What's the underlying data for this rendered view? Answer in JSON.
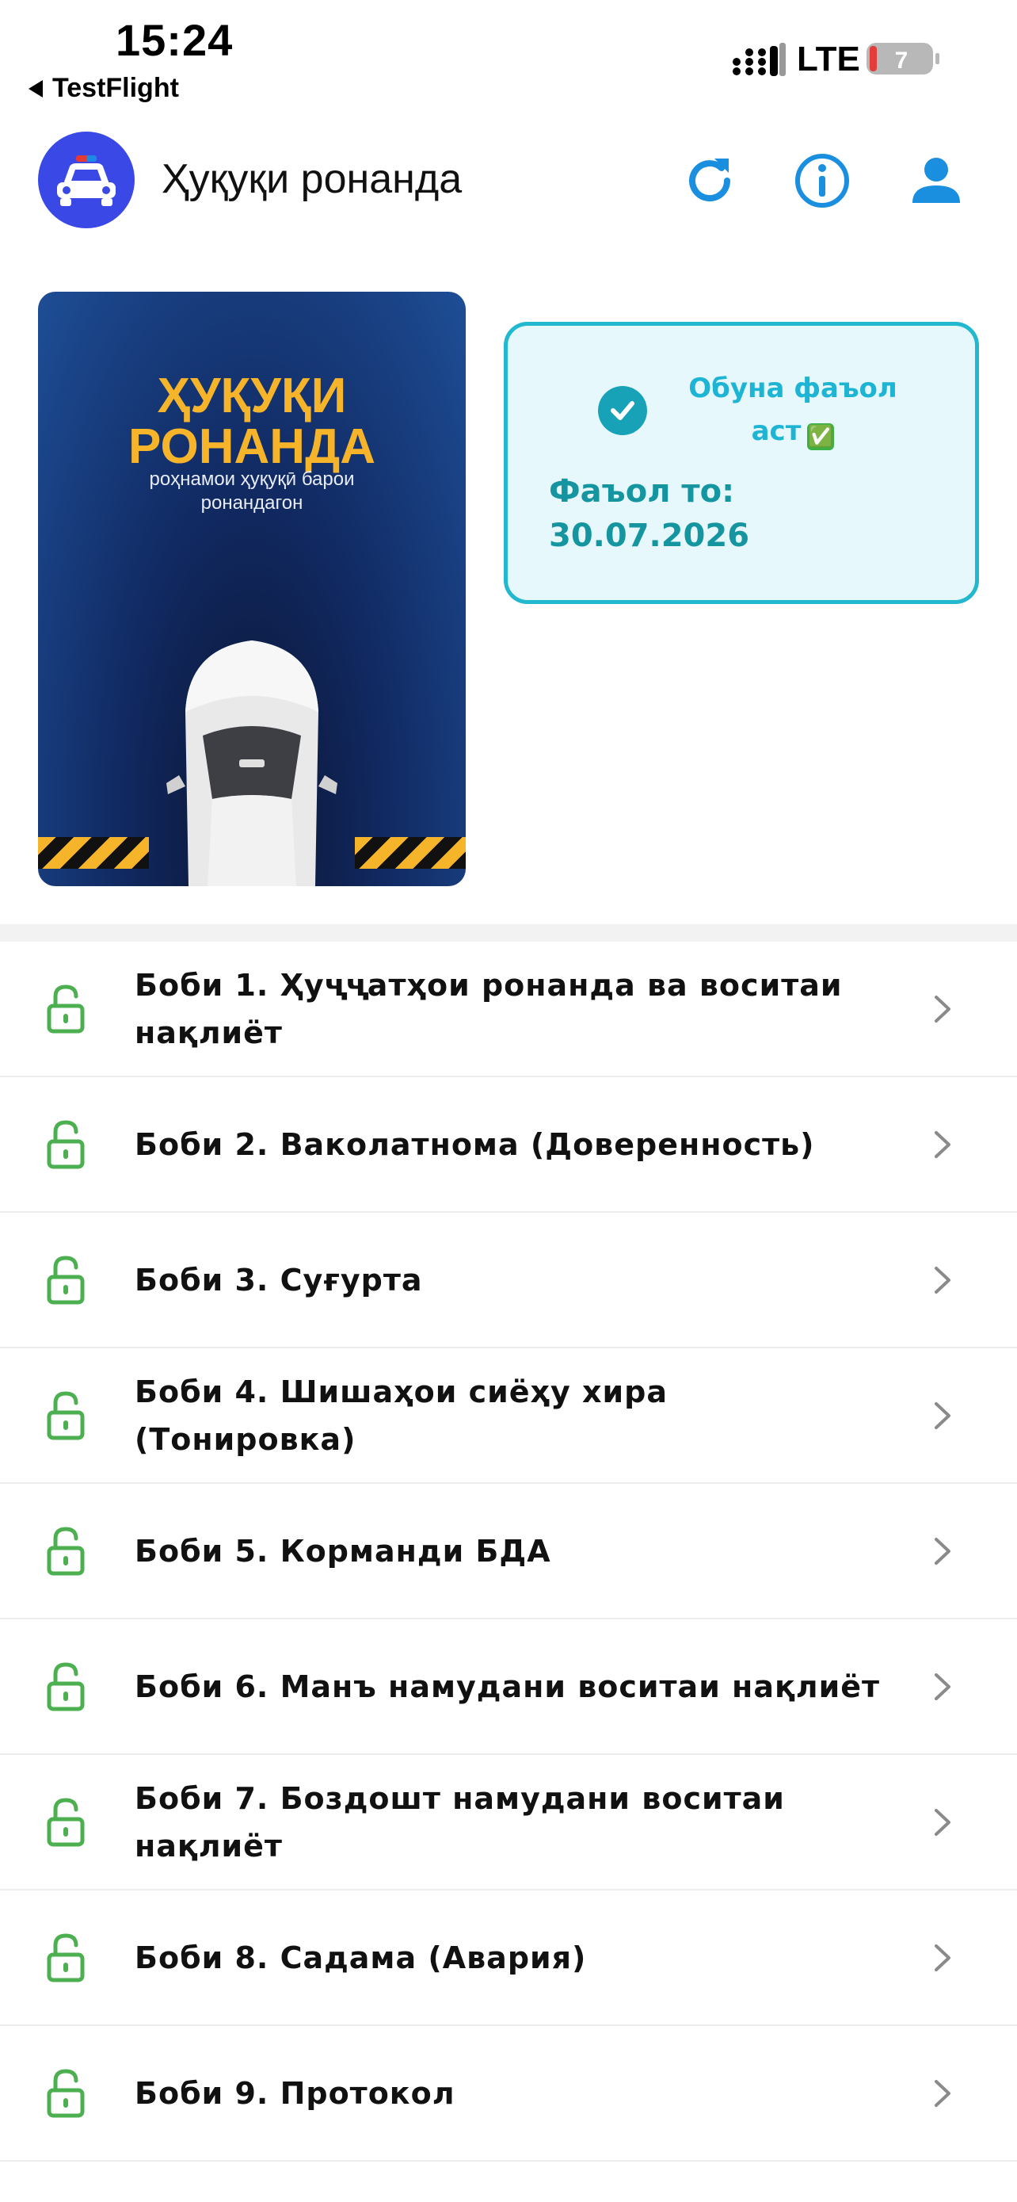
{
  "status_bar": {
    "time": "15:24",
    "back_label": "TestFlight",
    "network": "LTE",
    "battery": "7"
  },
  "header": {
    "title": "Ҳуқуқи ронанда",
    "icons": [
      "refresh-icon",
      "info-icon",
      "profile-icon"
    ]
  },
  "cover": {
    "title_line1": "ҲУҚУҚИ",
    "title_line2": "РОНАНДА",
    "subtitle_line1": "роҳнамои ҳуқуқӣ барои",
    "subtitle_line2": "ронандагон"
  },
  "subscription": {
    "status_line1": "Обуна фаъол",
    "status_line2": "аст",
    "status_emoji": "✅",
    "until_label": "Фаъол то:",
    "until_date": "30.07.2026"
  },
  "chapters": [
    {
      "line1": "Боби 1. Ҳуҷҷатҳои ронанда ва воситаи",
      "line2": "нақлиёт"
    },
    {
      "line1": "Боби 2. Ваколатнома (Доверенность)",
      "line2": ""
    },
    {
      "line1": "Боби 3. Суғурта",
      "line2": ""
    },
    {
      "line1": "Боби 4. Шишаҳои сиёҳу хира",
      "line2": "(Тонировка)"
    },
    {
      "line1": "Боби 5. Корманди БДА",
      "line2": ""
    },
    {
      "line1": "Боби 6. Манъ намудани воситаи нақлиёт",
      "line2": ""
    },
    {
      "line1": "Боби 7. Боздошт намудани воситаи",
      "line2": "нақлиёт"
    },
    {
      "line1": "Боби 8. Садама (Авария)",
      "line2": ""
    },
    {
      "line1": "Боби 9. Протокол",
      "line2": ""
    }
  ],
  "colors": {
    "accent_blue": "#1a8fe0",
    "logo_blue": "#3a48e6",
    "subscription_border": "#22b8cf",
    "subscription_bg": "#e6f8fb",
    "subscription_text": "#14959f",
    "unlocked_green": "#4caf50",
    "cover_yellow": "#f6b42b"
  }
}
